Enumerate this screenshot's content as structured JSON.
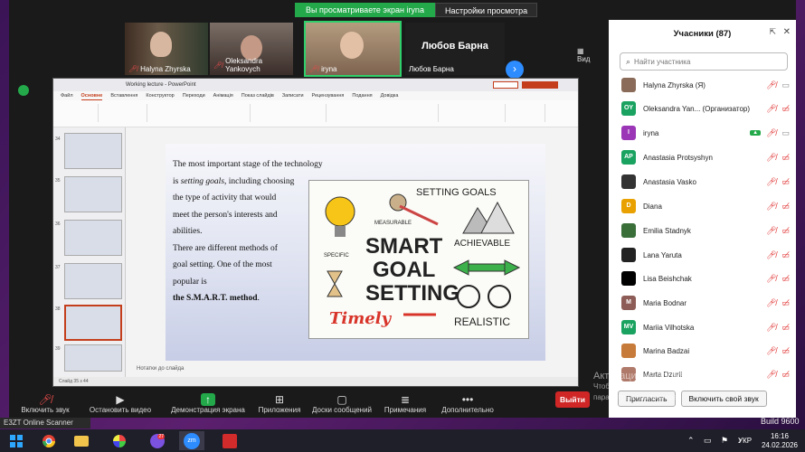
{
  "share_bar": {
    "status": "Вы просматриваете экран iryna",
    "options": "Настройки просмотра"
  },
  "gallery": {
    "tiles": [
      {
        "name": "Halyna Zhyrska",
        "muted": true
      },
      {
        "name": "Oleksandra Yankovych",
        "muted": true
      },
      {
        "name": "iryna",
        "muted": true
      }
    ],
    "name_tile": {
      "big": "Любов Барна",
      "small": "Любов Барна"
    },
    "view_label": "Вид"
  },
  "slide": {
    "line1": "The most important stage of the technology",
    "line2_pre": "is ",
    "line2_em": "setting goals",
    "line2_post": ", including choosing",
    "line3": "the type of activity that would",
    "line4": "meet the person's interests and",
    "line5": "abilities.",
    "line6": "There are different methods of",
    "line7": "goal setting. One of the most",
    "line8": "popular is",
    "line9_b": "the S.M.A.R.T. method",
    "line9_post": ".",
    "image_text": {
      "header": "SETTING GOALS",
      "measurable": "MEASURABLE",
      "specific": "SPECIFIC",
      "achievable": "ACHIEVABLE",
      "smart": "SMART",
      "goal": "GOAL",
      "setting": "SETTING",
      "timely": "Timely",
      "realistic": "REALISTIC"
    }
  },
  "ppt": {
    "title": "Working lecture - PowerPoint",
    "tabs": [
      "Файл",
      "Основне",
      "Вставлення",
      "Конструктор",
      "Переходи",
      "Анімація",
      "Показ слайдів",
      "Записати",
      "Рецензування",
      "Подання",
      "Довідка"
    ],
    "notes": "Нотатки до слайда",
    "status": "Слайд 35 з 44",
    "thumb_numbers": [
      "34",
      "35",
      "36",
      "37",
      "38",
      "39"
    ]
  },
  "participants": {
    "title": "Учасники (87)",
    "search_placeholder": "Найти участника",
    "list": [
      {
        "name": "Halyna Zhyrska (Я)",
        "initials": "",
        "color": "#8a6a58"
      },
      {
        "name": "Oleksandra Yan... (Организатор)",
        "initials": "OY",
        "color": "#1aa260"
      },
      {
        "name": "iryna",
        "initials": "I",
        "color": "#9b36b7"
      },
      {
        "name": "Anastasia Protsyshyn",
        "initials": "AP",
        "color": "#1aa260"
      },
      {
        "name": "Anastasia Vasko",
        "initials": "",
        "color": "#333333"
      },
      {
        "name": "Diana",
        "initials": "D",
        "color": "#e8a100"
      },
      {
        "name": "Emilia Stadnyk",
        "initials": "",
        "color": "#3a6f3a"
      },
      {
        "name": "Lana Yaruta",
        "initials": "",
        "color": "#222222"
      },
      {
        "name": "Lisa Beishchak",
        "initials": "",
        "color": "#000000"
      },
      {
        "name": "Maria Bodnar",
        "initials": "M",
        "color": "#8d5c56"
      },
      {
        "name": "Mariia Vilhotska",
        "initials": "MV",
        "color": "#1aa260"
      },
      {
        "name": "Marina Badzai",
        "initials": "",
        "color": "#c77b3a"
      },
      {
        "name": "Marta Dzurii",
        "initials": "",
        "color": "#b07a6a"
      }
    ],
    "invite": "Пригласить",
    "unmute_me": "Включить свой звук"
  },
  "watermark": {
    "line1": "Активация Windows",
    "line2": "Чтобы активировать Windows, перейдите к",
    "line3": "параметрам компьютера."
  },
  "build": "Build 9600",
  "toolbar": {
    "unmute": "Включить звук",
    "stop_video": "Остановить видео",
    "share": "Демонстрация экрана",
    "apps": "Приложения",
    "chat": "Доски сообщений",
    "notes": "Примечания",
    "more": "Дополнительно",
    "leave": "Выйти"
  },
  "scanner": "E3ZT Online Scanner",
  "taskbar": {
    "lang": "УКР",
    "time": "16:16",
    "date": "24.02.2026",
    "viber_badge": "27"
  }
}
